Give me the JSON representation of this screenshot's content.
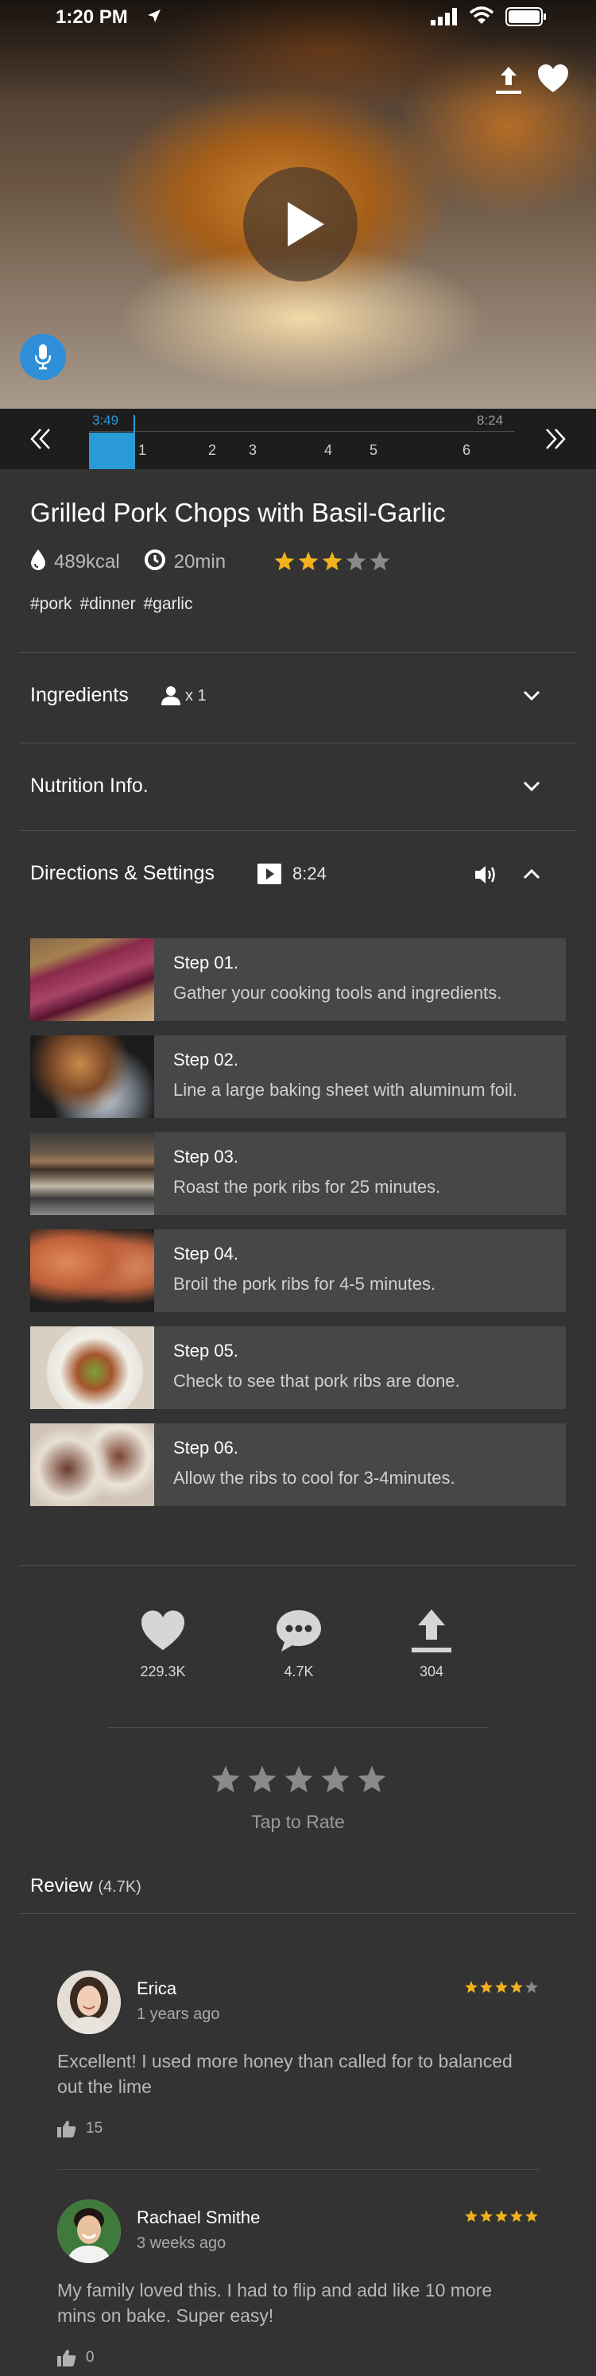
{
  "status": {
    "time": "1:20 PM"
  },
  "timeline": {
    "current": "3:49",
    "total": "8:24",
    "progress": 0.4544,
    "markers": [
      "1",
      "2",
      "3",
      "4",
      "5",
      "6"
    ]
  },
  "recipe": {
    "title": "Grilled Pork Chops with Basil-Garlic",
    "calories": "489kcal",
    "time": "20min",
    "rating": 3,
    "rating_max": 5,
    "tags": [
      "#pork",
      "#dinner",
      "#garlic"
    ]
  },
  "sections": {
    "ingredients": {
      "label": "Ingredients",
      "servings": "x 1"
    },
    "nutrition": {
      "label": "Nutrition Info."
    },
    "directions": {
      "label": "Directions & Settings",
      "duration": "8:24"
    }
  },
  "steps": [
    {
      "title": "Step 01.",
      "text": "Gather your cooking tools and ingredients."
    },
    {
      "title": "Step 02.",
      "text": "Line a large baking sheet with aluminum foil."
    },
    {
      "title": "Step 03.",
      "text": "Roast the pork ribs for 25 minutes."
    },
    {
      "title": "Step 04.",
      "text": "Broil the pork ribs for 4-5 minutes."
    },
    {
      "title": "Step 05.",
      "text": "Check to see that pork ribs are done."
    },
    {
      "title": "Step 06.",
      "text": "Allow the ribs to cool for 3-4minutes."
    }
  ],
  "social": {
    "likes": "229.3K",
    "comments": "4.7K",
    "shares": "304"
  },
  "rate": {
    "label": "Tap to Rate"
  },
  "reviews_section": {
    "label": "Review",
    "count": "(4.7K)"
  },
  "reviews": [
    {
      "name": "Erica",
      "time": "1 years ago",
      "rating": 4,
      "text": "Excellent! I used more honey than called for  to balanced out the lime",
      "likes": "15"
    },
    {
      "name": "Rachael Smithe",
      "time": "3 weeks ago",
      "rating": 5,
      "text": "My family loved this. I had to flip and add like 10 more mins on bake. Super easy!",
      "likes": "0"
    }
  ],
  "colors": {
    "accent": "#2a9ad6",
    "star_on": "#f2b21d",
    "star_off": "#8a8a8a",
    "background": "#333333"
  },
  "icons": {
    "hero": [
      "share-icon",
      "heart-icon",
      "play-icon",
      "microphone-icon"
    ],
    "timeline": [
      "double-chevron-left-icon",
      "double-chevron-right-icon"
    ],
    "meta": [
      "calorie-drop-icon",
      "clock-icon",
      "star-icon"
    ],
    "sections": [
      "person-icon",
      "chevron-down-icon",
      "chevron-up-icon",
      "video-icon",
      "volume-icon"
    ],
    "social": [
      "heart-icon",
      "comment-icon",
      "share-icon"
    ],
    "review": [
      "thumbs-up-icon"
    ]
  }
}
